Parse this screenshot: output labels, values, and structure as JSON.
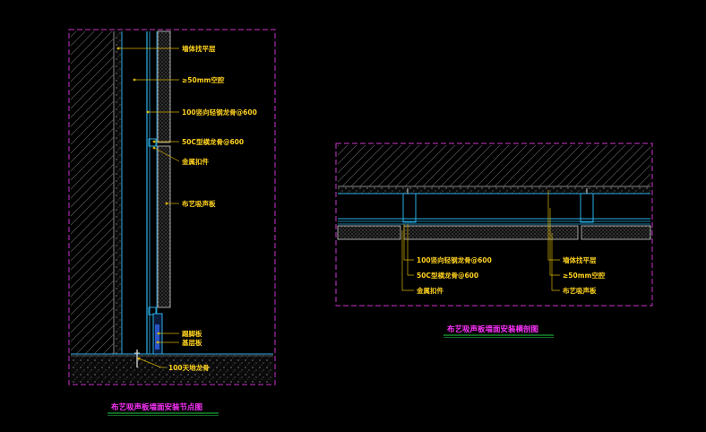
{
  "colors": {
    "background": "#000000",
    "frame": "#cc33cc",
    "label": "#ffd21e",
    "leader": "#d4b000",
    "title": "#ff33ff",
    "underline": "#22cc44",
    "panel": "#2ab0e8",
    "hatch": "#606060",
    "panel_core": "#b8b8b8"
  },
  "section_view": {
    "title": "布艺吸声板墙面安装节点图",
    "labels": {
      "leveling_layer": "墙体找平层",
      "air_gap": "≥50mm空腔",
      "vertical_keel": "100竖向轻钢龙骨@600",
      "transverse_keel": "50C型横龙骨@600",
      "metal_clip": "金属扣件",
      "fabric_panel": "布艺吸声板",
      "moisture_board": "踢脚板",
      "base_board": "基层板",
      "floor_keel": "100天地龙骨"
    }
  },
  "plan_view": {
    "title": "布艺吸声板墙面安装横剖图",
    "labels": {
      "vertical_keel": "100竖向轻钢龙骨@600",
      "transverse_keel": "50C型横龙骨@600",
      "metal_clip": "金属扣件",
      "leveling_layer": "墙体找平层",
      "air_gap": "≥50mm空腔",
      "fabric_panel": "布艺吸声板"
    }
  }
}
